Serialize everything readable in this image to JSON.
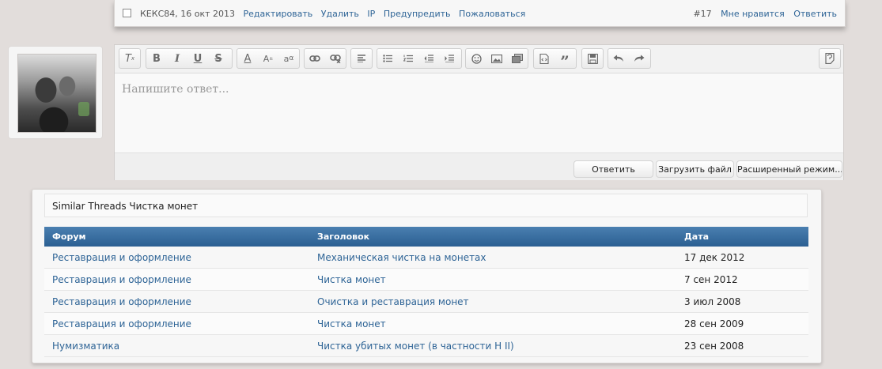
{
  "post_footer": {
    "author_date": "КЕКС84, 16 окт 2013",
    "actions": [
      "Редактировать",
      "Удалить",
      "IP",
      "Предупредить",
      "Пожаловаться"
    ],
    "post_number": "#17",
    "like": "Мне нравится",
    "reply": "Ответить"
  },
  "editor": {
    "toolbar_icons": [
      "remove-format-icon",
      "bold-icon",
      "italic-icon",
      "underline-icon",
      "strikethrough-icon",
      "font-color-icon",
      "font-size-icon",
      "font-family-icon",
      "link-icon",
      "unlink-icon",
      "align-icon",
      "bulleted-list-icon",
      "numbered-list-icon",
      "outdent-icon",
      "indent-icon",
      "smiley-icon",
      "image-icon",
      "media-icon",
      "code-icon",
      "quote-icon",
      "save-draft-icon",
      "undo-icon",
      "redo-icon",
      "toggle-source-icon"
    ],
    "placeholder": "Напишите ответ...",
    "buttons": {
      "reply": "Ответить",
      "upload": "Загрузить файл",
      "advanced": "Расширенный режим..."
    }
  },
  "similar": {
    "title": "Similar Threads Чистка монет",
    "columns": [
      "Форум",
      "Заголовок",
      "Дата"
    ],
    "rows": [
      {
        "forum": "Реставрация и оформление",
        "title": "Механическая чистка на монетах",
        "date": "17 дек 2012"
      },
      {
        "forum": "Реставрация и оформление",
        "title": "Чистка монет",
        "date": "7 сен 2012"
      },
      {
        "forum": "Реставрация и оформление",
        "title": "Очистка и реставрация монет",
        "date": "3 июл 2008"
      },
      {
        "forum": "Реставрация и оформление",
        "title": "Чистка монет",
        "date": "28 сен 2009"
      },
      {
        "forum": "Нумизматика",
        "title": "Чистка убитых монет (в частности Н II)",
        "date": "23 сен 2008"
      }
    ]
  },
  "colors": {
    "link": "#2e6496",
    "table_header": "#3a6fa2",
    "page_background": "#e2dddb"
  }
}
